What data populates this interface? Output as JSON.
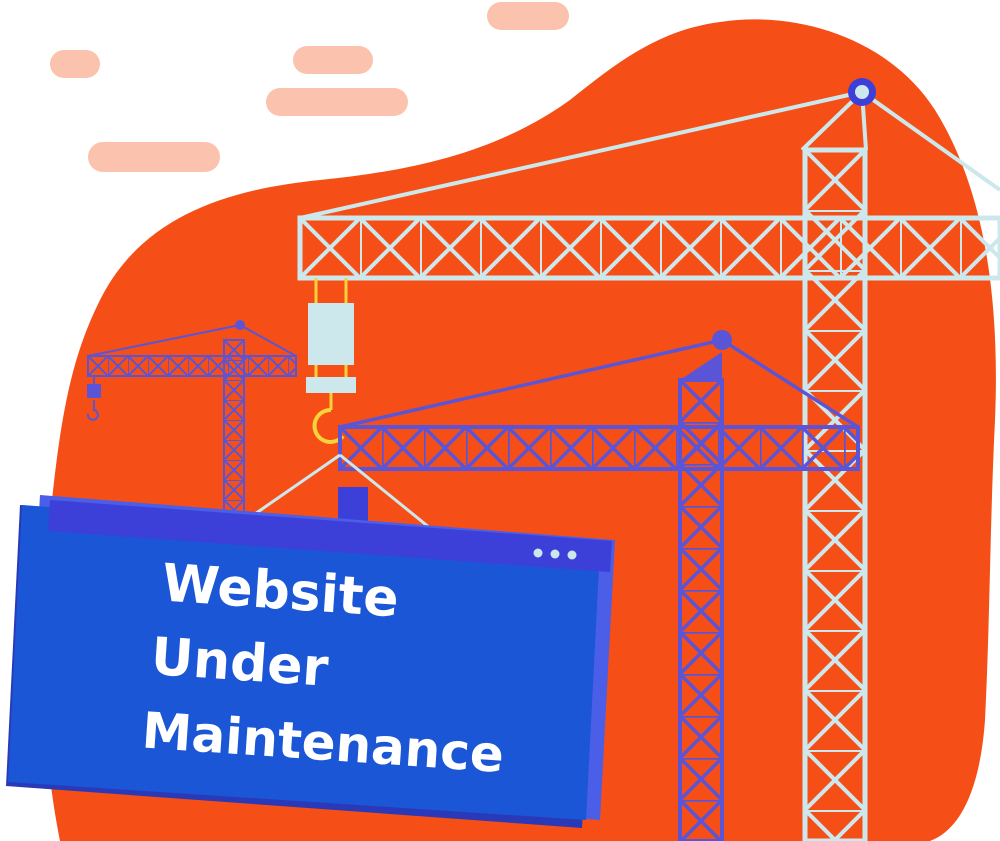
{
  "sign": {
    "line1": "Website",
    "line2": "Under",
    "line3": "Maintenance"
  },
  "colors": {
    "blob": "#f54f17",
    "cloud": "#fbc3ad",
    "crane_light": "#cde8ec",
    "crane_blue": "#5a55d6",
    "sign_front": "#1a56d6",
    "sign_back": "#4a5ee8",
    "sign_bar": "#3d3fd9",
    "hook": "#f6d23b"
  },
  "icons": [
    "window-dots-icon",
    "crane-hook-icon"
  ]
}
